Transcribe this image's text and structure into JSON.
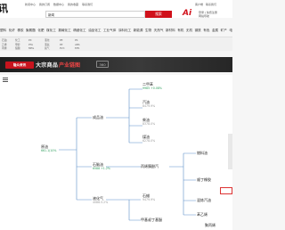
{
  "topbar": {
    "logo": "讯",
    "nav": [
      "新闻中心",
      "我的订阅",
      "数据中心",
      "我的收藏",
      "联系我们"
    ],
    "right_nav": [
      "客户端",
      "",
      "联系我们"
    ],
    "search": {
      "category": "新闻"
    },
    "search_button": "搜索",
    "right_links": [
      "登录 | 免费注册",
      "网站导航"
    ]
  },
  "categories": [
    "塑料",
    "化纤",
    "橡胶",
    "聚氨酯",
    "化肥",
    "煤化工",
    "氯碱化工",
    "精细化工",
    "油品化工",
    "工业气体",
    "涂料化工",
    "新能源",
    "生物",
    "天然气",
    "新材料",
    "有机",
    "无机",
    "钢铁",
    "有色",
    "金属",
    "矿产",
    "电力",
    "节能",
    "水泥",
    "纺织",
    "环保",
    "医药",
    "装备",
    "制药"
  ],
  "subnav": {
    "col1": [
      "石油",
      "乙烯",
      "丙烯"
    ],
    "col2": [
      "化工",
      "甲醇",
      "醋酸"
    ],
    "col3": [
      "PX",
      "PTA",
      "MEG"
    ],
    "col4": [
      "液化",
      "液氨",
      "氮气"
    ],
    "col5": [
      "PE",
      "PP",
      "PVC"
    ],
    "col6": [
      "PS",
      "ABS",
      "EPS"
    ]
  },
  "banner": {
    "logo": "隆众资讯",
    "title": "大宗商品",
    "subtitle": "产业链图",
    "badge": "360"
  },
  "chain": {
    "nodes": {
      "a": {
        "name": "原油",
        "value": "661.1(10%"
      },
      "b": {
        "name": "成品油",
        "value": ""
      },
      "c": {
        "name": "石脑油",
        "value": "6588 +1.2%"
      },
      "d": {
        "name": "液化气",
        "value": "4088.5.2%"
      },
      "e": {
        "name": "石蜡",
        "value": "9479.9%"
      },
      "f": {
        "name": "二甲苯",
        "value": "9985 +0.08%"
      },
      "g": {
        "name": "汽油",
        "value": "8479.9%"
      },
      "h": {
        "name": "柴油",
        "value": "8378.0%"
      },
      "i": {
        "name": "煤油",
        "value": "6278.0%"
      },
      "j": {
        "name": "丙烯腈酚汽",
        "value": ""
      },
      "k": {
        "name": "燃料油",
        "value": ""
      },
      "l": {
        "name": "顺丁橡胶",
        "value": ""
      },
      "m": {
        "name": "混炼汽油",
        "value": ""
      },
      "n": {
        "name": "苯乙烯",
        "value": ""
      },
      "o": {
        "name": "甲基叔丁基醚",
        "value": ""
      },
      "p": {
        "name": "聚丙烯",
        "value": ""
      }
    }
  }
}
